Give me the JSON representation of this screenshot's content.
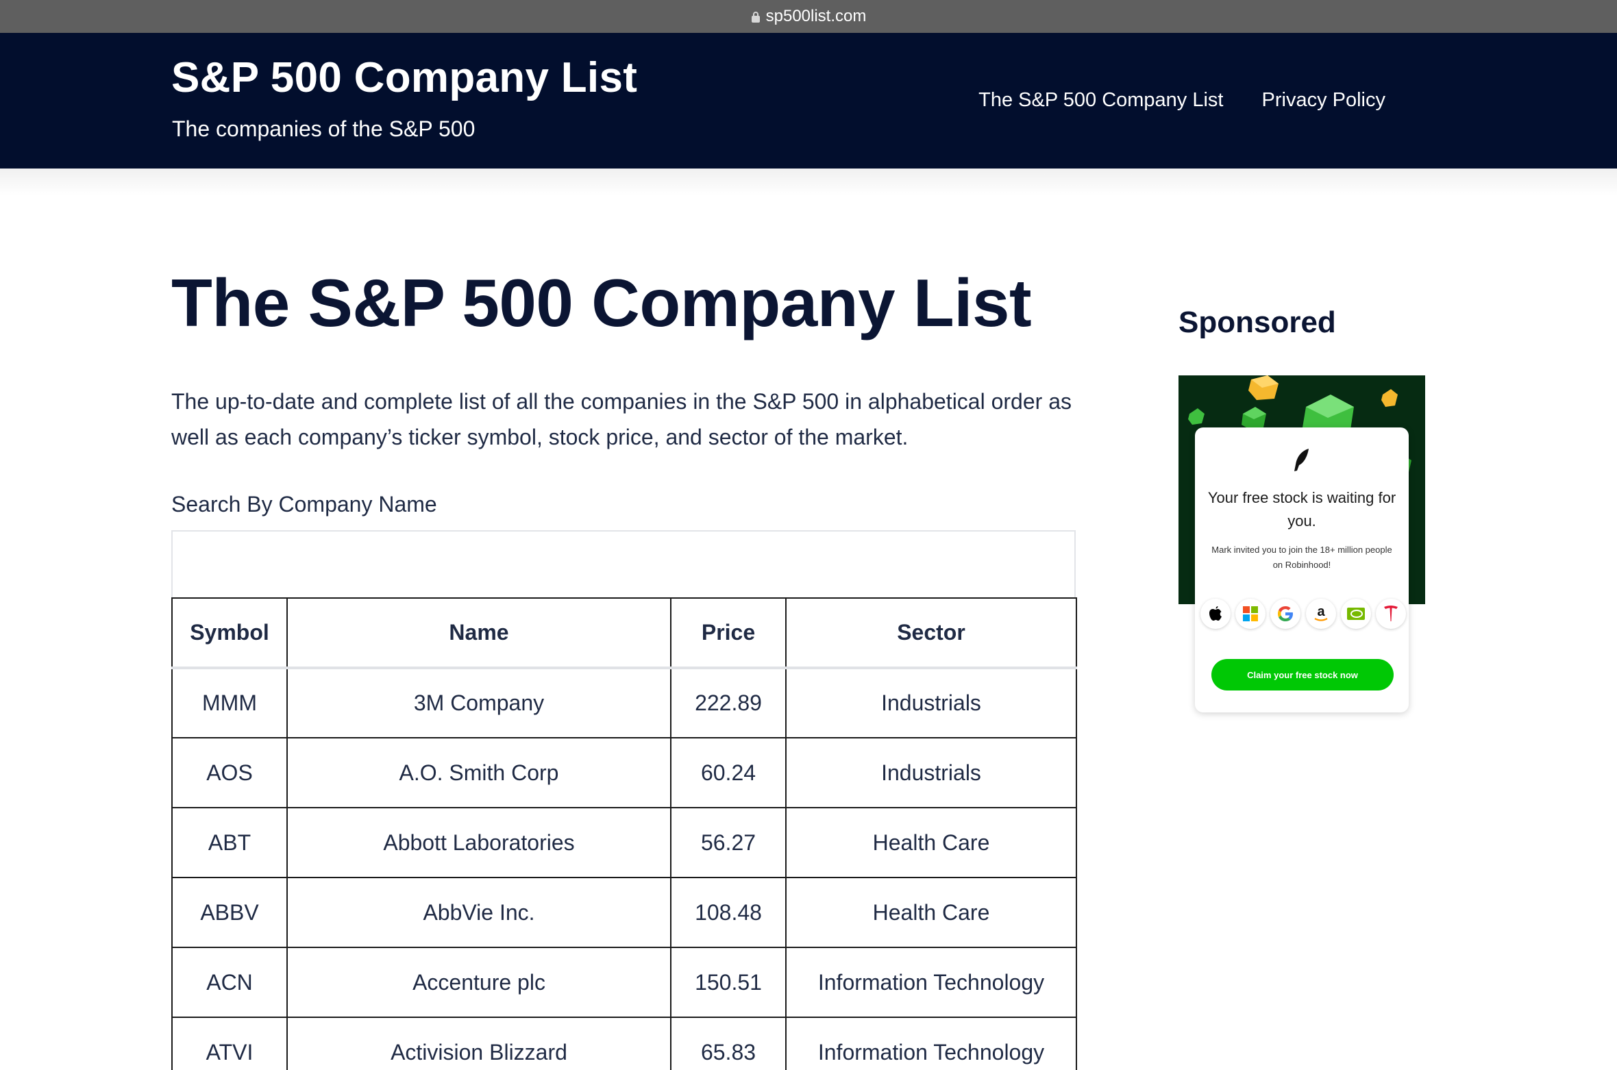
{
  "browser": {
    "url": "sp500list.com"
  },
  "header": {
    "site_title": "S&P 500 Company List",
    "tagline": "The companies of the S&P 500",
    "nav": [
      {
        "label": "The S&P 500 Company List"
      },
      {
        "label": "Privacy Policy"
      }
    ]
  },
  "main": {
    "title": "The S&P 500 Company List",
    "intro": "The up-to-date and complete list of all the companies in the S&P 500 in alphabetical order as well as each company’s ticker symbol, stock price, and sector of the market.",
    "search": {
      "label": "Search By Company Name",
      "value": ""
    },
    "table": {
      "headers": [
        "Symbol",
        "Name",
        "Price",
        "Sector"
      ],
      "rows": [
        [
          "MMM",
          "3M Company",
          "222.89",
          "Industrials"
        ],
        [
          "AOS",
          "A.O. Smith Corp",
          "60.24",
          "Industrials"
        ],
        [
          "ABT",
          "Abbott Laboratories",
          "56.27",
          "Health Care"
        ],
        [
          "ABBV",
          "AbbVie Inc.",
          "108.48",
          "Health Care"
        ],
        [
          "ACN",
          "Accenture plc",
          "150.51",
          "Information Technology"
        ],
        [
          "ATVI",
          "Activision Blizzard",
          "65.83",
          "Information Technology"
        ]
      ]
    }
  },
  "sidebar": {
    "heading": "Sponsored",
    "ad": {
      "headline": "Your free stock is waiting for you.",
      "subtext": "Mark invited you to join the 18+ million people on Robinhood!",
      "cta": "Claim your free stock now",
      "brand_color": "#00c805",
      "logos": [
        "apple-icon",
        "microsoft-icon",
        "google-icon",
        "amazon-icon",
        "nvidia-icon",
        "tesla-icon"
      ]
    }
  },
  "colors": {
    "header_bg": "#020e2d",
    "text": "#0b1533"
  }
}
